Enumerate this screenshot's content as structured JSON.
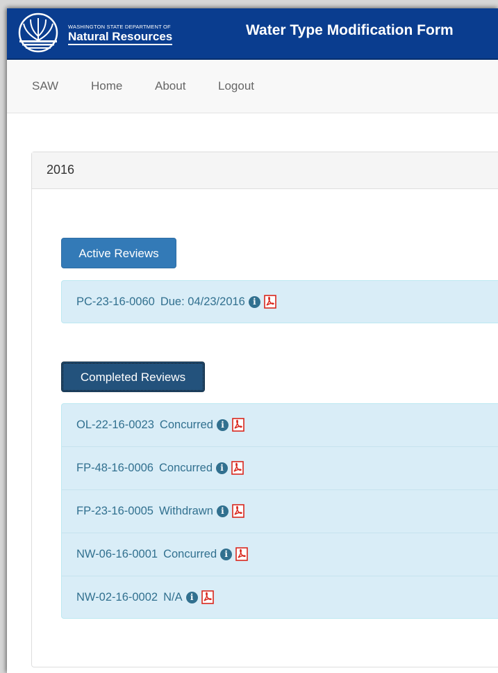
{
  "header": {
    "agency_small": "WASHINGTON STATE DEPARTMENT OF",
    "agency_big": "Natural Resources",
    "title": "Water Type Modification Form",
    "background_color": "#0a3d8f"
  },
  "nav": {
    "items": [
      {
        "label": "SAW"
      },
      {
        "label": "Home"
      },
      {
        "label": "About"
      },
      {
        "label": "Logout"
      }
    ]
  },
  "panel": {
    "title": "2016",
    "active": {
      "button_label": "Active Reviews",
      "items": [
        {
          "id": "PC-23-16-0060",
          "status": "Due: 04/23/2016",
          "icons": [
            "info-icon",
            "pdf-icon"
          ]
        }
      ]
    },
    "completed": {
      "button_label": "Completed Reviews",
      "items": [
        {
          "id": "OL-22-16-0023",
          "status": "Concurred",
          "icons": [
            "info-icon",
            "pdf-icon"
          ]
        },
        {
          "id": "FP-48-16-0006",
          "status": "Concurred",
          "icons": [
            "info-icon",
            "pdf-icon"
          ]
        },
        {
          "id": "FP-23-16-0005",
          "status": "Withdrawn",
          "icons": [
            "info-icon",
            "pdf-icon"
          ]
        },
        {
          "id": "NW-06-16-0001",
          "status": "Concurred",
          "icons": [
            "info-icon",
            "pdf-icon"
          ]
        },
        {
          "id": "NW-02-16-0002",
          "status": "N/A",
          "icons": [
            "info-icon",
            "pdf-icon"
          ]
        }
      ]
    }
  },
  "colors": {
    "link": "#31708f",
    "list_bg": "#d9edf7",
    "btn_primary": "#337ab7",
    "btn_pressed": "#23527c",
    "pdf_red": "#d9261c"
  }
}
